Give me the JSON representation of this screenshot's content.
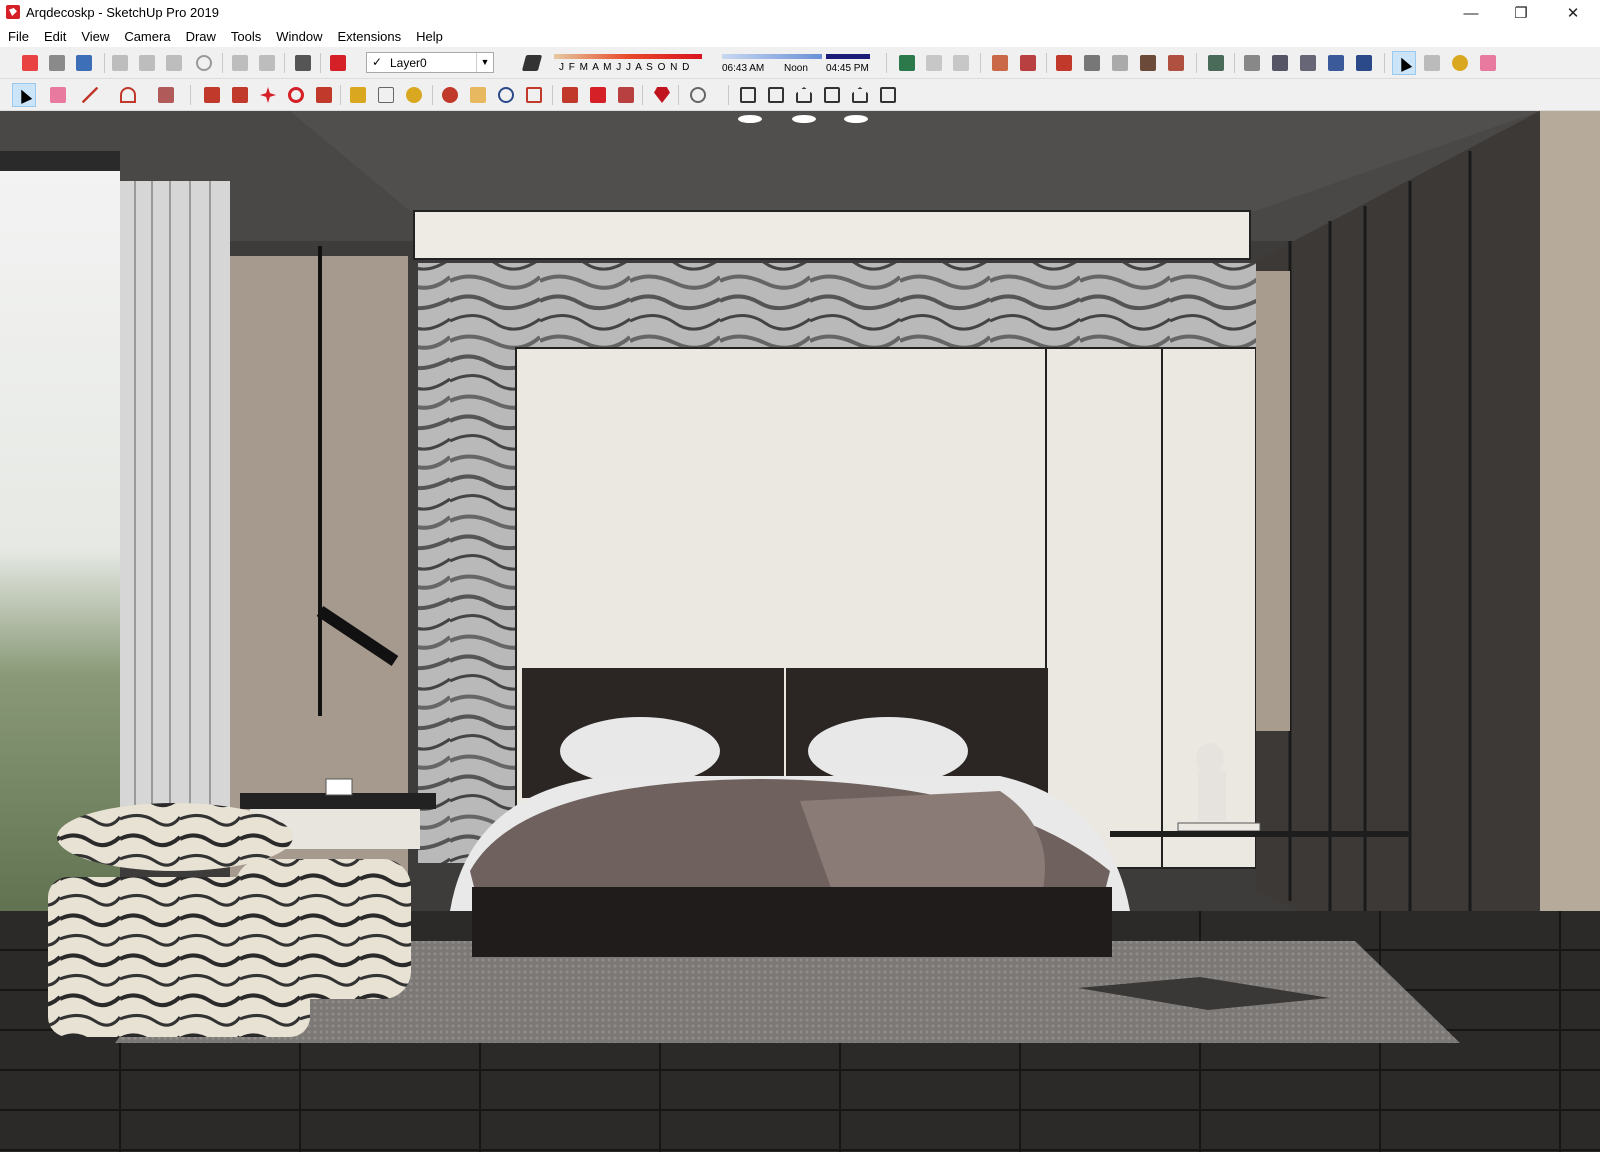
{
  "window": {
    "title": "Arqdecoskp - SketchUp Pro 2019",
    "minimize_glyph": "—",
    "restore_glyph": "❐",
    "close_glyph": "✕"
  },
  "menu": [
    "File",
    "Edit",
    "View",
    "Camera",
    "Draw",
    "Tools",
    "Window",
    "Extensions",
    "Help"
  ],
  "layer": {
    "check": "✓",
    "name": "Layer0"
  },
  "shadows": {
    "months": "J F M A M J J A S O N D",
    "time_start": "06:43 AM",
    "time_noon": "Noon",
    "time_end": "04:45 PM"
  },
  "colors": {
    "accent": "#d62027",
    "toolbar_bg": "#f0f0f0",
    "selected": "#cce4f7"
  },
  "toolbar1_icons": [
    "new-file-icon",
    "open-folder-icon",
    "save-icon",
    "cut-icon",
    "copy-icon",
    "paste-icon",
    "erase-icon",
    "undo-icon",
    "redo-icon",
    "print-icon",
    "model-info-icon",
    "shadow-toggle-icon",
    "foursquare-icon",
    "sandbox-icon",
    "stamp-icon",
    "texture-icon",
    "paint-bucket-icon",
    "section-plane-icon",
    "iso-view-icon",
    "top-view-icon",
    "front-view-icon",
    "right-view-icon",
    "back-view-icon",
    "select-icon",
    "eraser-icon"
  ],
  "toolbar2_icons": [
    "select-icon",
    "eraser-icon",
    "line-icon",
    "arc-icon",
    "rectangle-icon",
    "push-pull-icon",
    "follow-me-icon",
    "move-icon",
    "rotate-icon",
    "scale-icon",
    "tape-measure-icon",
    "text-icon",
    "paint-icon",
    "orbit-icon",
    "pan-icon",
    "zoom-icon",
    "zoom-extents-icon",
    "warehouse-icon",
    "extension-warehouse-icon",
    "layout-icon",
    "ruby-icon",
    "user-icon",
    "iso-icon",
    "top-icon",
    "front-icon",
    "right-icon",
    "back-icon",
    "left-icon"
  ]
}
